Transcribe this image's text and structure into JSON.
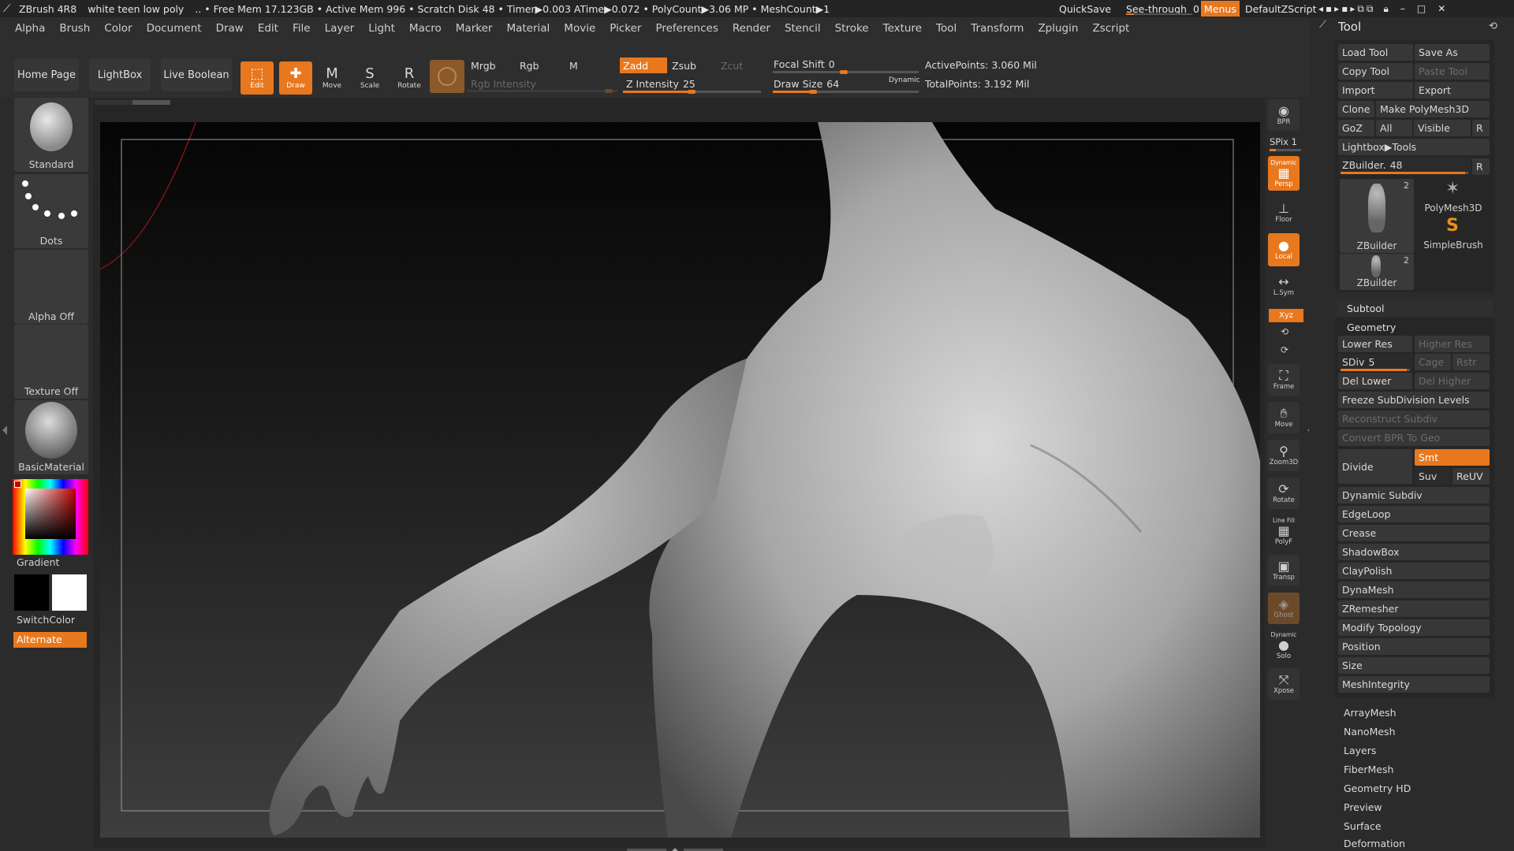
{
  "app": {
    "title": "ZBrush 4R8",
    "document": "white teen low poly",
    "info": ".. • Free Mem 17.123GB • Active Mem 996 • Scratch Disk 48 • Timer▶0.003 ATime▶0.072 • PolyCount▶3.06 MP • MeshCount▶1"
  },
  "titlebar_right": {
    "quicksave": "QuickSave",
    "see_through_label": "See-through",
    "see_through_value": "0",
    "menus": "Menus",
    "script": "DefaultZScript"
  },
  "menu": [
    "Alpha",
    "Brush",
    "Color",
    "Document",
    "Draw",
    "Edit",
    "File",
    "Layer",
    "Light",
    "Macro",
    "Marker",
    "Material",
    "Movie",
    "Picker",
    "Preferences",
    "Render",
    "Stencil",
    "Stroke",
    "Texture",
    "Tool",
    "Transform",
    "Zplugin",
    "Zscript"
  ],
  "shelf": {
    "home_page": "Home Page",
    "lightbox": "LightBox",
    "live_boolean": "Live Boolean",
    "edit": "Edit",
    "draw": "Draw",
    "move": "Move",
    "scale": "Scale",
    "rotate": "Rotate",
    "mrgb": "Mrgb",
    "rgb": "Rgb",
    "m": "M",
    "rgb_intensity": "Rgb Intensity",
    "zadd": "Zadd",
    "zsub": "Zsub",
    "zcut": "Zcut",
    "z_intensity_label": "Z Intensity",
    "z_intensity_value": "25",
    "focal_shift_label": "Focal Shift",
    "focal_shift_value": "0",
    "draw_size_label": "Draw Size",
    "draw_size_value": "64",
    "dynamic": "Dynamic",
    "active_points": "ActivePoints: 3.060 Mil",
    "total_points": "TotalPoints: 3.192 Mil"
  },
  "left": {
    "brush": "Standard",
    "stroke": "Dots",
    "alpha": "Alpha Off",
    "texture": "Texture Off",
    "material": "BasicMaterial",
    "gradient": "Gradient",
    "switch_color": "SwitchColor",
    "alternate": "Alternate"
  },
  "right_tools": {
    "bpr": "BPR",
    "spix": "SPix 1",
    "dynamic": "Dynamic",
    "persp": "Persp",
    "floor": "Floor",
    "local": "Local",
    "lsym": "L.Sym",
    "xyz": "Xyz",
    "frame": "Frame",
    "move": "Move",
    "zoom3d": "Zoom3D",
    "rotate": "Rotate",
    "line_fill": "Line Fill",
    "polyf": "PolyF",
    "transp": "Transp",
    "ghost": "Ghost",
    "dynamic2": "Dynamic",
    "solo": "Solo",
    "xpose": "Xpose"
  },
  "tool_panel": {
    "title": "Tool",
    "load_tool": "Load Tool",
    "save_as": "Save As",
    "copy_tool": "Copy Tool",
    "paste_tool": "Paste Tool",
    "import": "Import",
    "export": "Export",
    "clone": "Clone",
    "make_polymesh": "Make PolyMesh3D",
    "goz": "GoZ",
    "all": "All",
    "visible": "Visible",
    "r": "R",
    "lightbox_tools": "Lightbox▶Tools",
    "zbuilder_label": "ZBuilder.",
    "zbuilder_value": "48",
    "thumb1_name": "ZBuilder",
    "thumb1_count": "2",
    "thumb2_name": "PolyMesh3D",
    "thumb3_name": "SimpleBrush",
    "thumb4_name": "ZBuilder",
    "thumb4_count": "2",
    "subtool": "Subtool",
    "geometry": "Geometry",
    "lower_res": "Lower Res",
    "higher_res": "Higher Res",
    "sdiv_label": "SDiv",
    "sdiv_value": "5",
    "cage": "Cage",
    "rstr": "Rstr",
    "del_lower": "Del Lower",
    "del_higher": "Del Higher",
    "freeze": "Freeze SubDivision Levels",
    "reconstruct": "Reconstruct Subdiv",
    "convert_bpr": "Convert BPR To Geo",
    "divide": "Divide",
    "smt": "Smt",
    "suv": "Suv",
    "reuv": "ReUV",
    "geometry_items": [
      "Dynamic Subdiv",
      "EdgeLoop",
      "Crease",
      "ShadowBox",
      "ClayPolish",
      "DynaMesh",
      "ZRemesher",
      "Modify Topology",
      "Position",
      "Size",
      "MeshIntegrity"
    ],
    "sections": [
      "ArrayMesh",
      "NanoMesh",
      "Layers",
      "FiberMesh",
      "Geometry HD",
      "Preview",
      "Surface",
      "Deformation"
    ]
  }
}
